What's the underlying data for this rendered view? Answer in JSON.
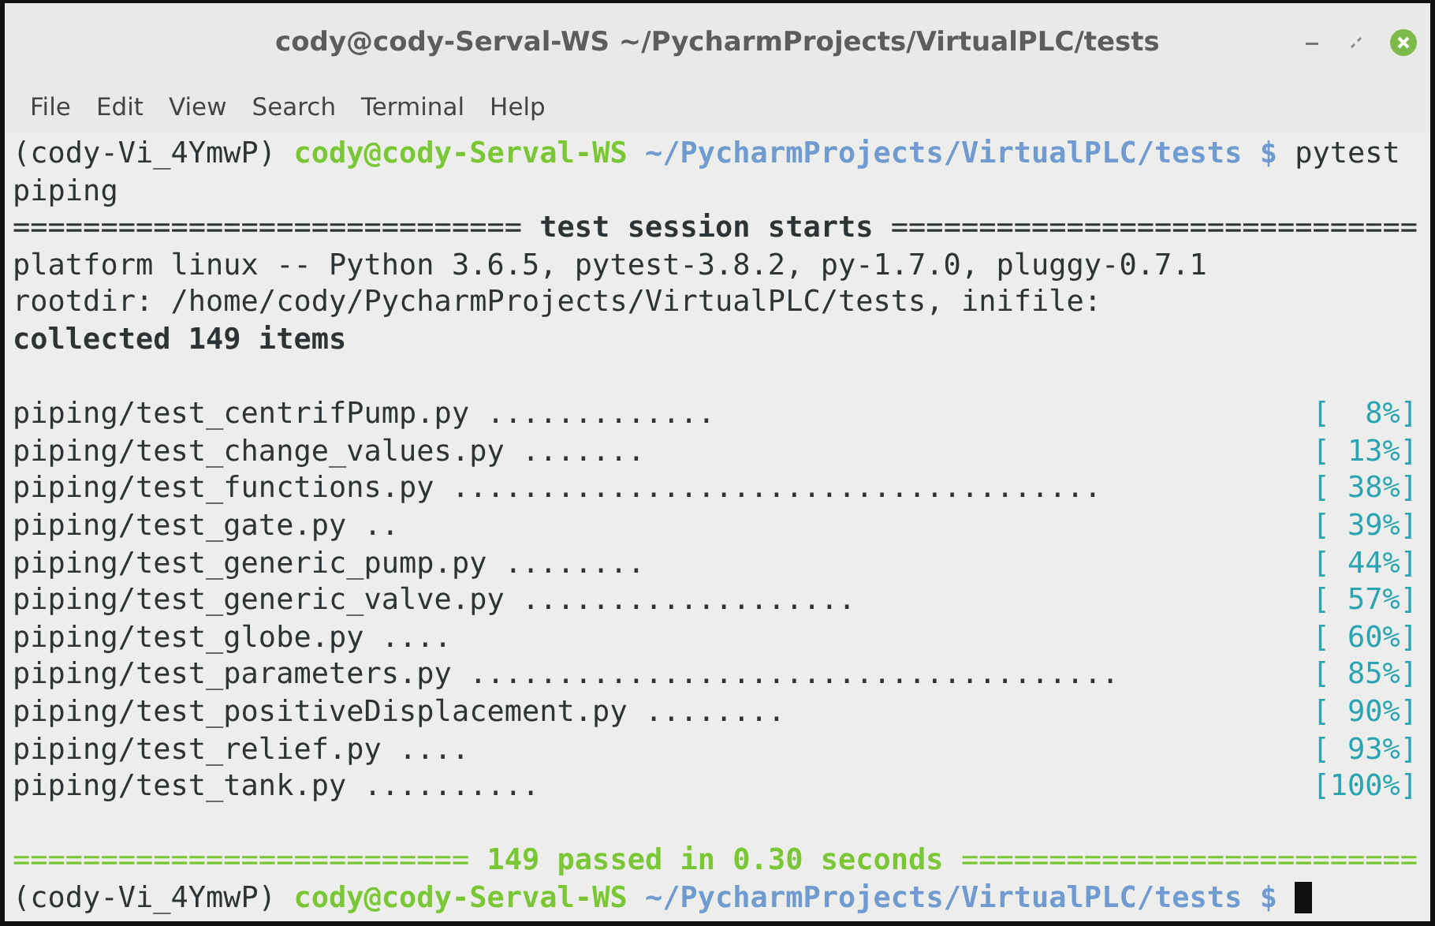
{
  "window": {
    "title": "cody@cody-Serval-WS ~/PycharmProjects/VirtualPLC/tests"
  },
  "menu": {
    "items": [
      "File",
      "Edit",
      "View",
      "Search",
      "Terminal",
      "Help"
    ]
  },
  "terminal": {
    "lines": [
      {
        "kind": "prompt",
        "env": "(cody-Vi_4YmwP)",
        "user_host": "cody@cody-Serval-WS",
        "path": "~/PycharmProjects/VirtualPLC/tests",
        "symbol": "$",
        "command": "pytest",
        "cursor": false
      },
      {
        "kind": "plain",
        "text": "piping"
      },
      {
        "kind": "separator",
        "text": "============================= **test session starts** =============================="
      },
      {
        "kind": "plain",
        "text": "platform linux -- Python 3.6.5, pytest-3.8.2, py-1.7.0, pluggy-0.7.1"
      },
      {
        "kind": "plain",
        "text": "rootdir: /home/cody/PycharmProjects/VirtualPLC/tests, inifile:"
      },
      {
        "kind": "bold",
        "text": "collected 149 items"
      },
      {
        "kind": "blank"
      },
      {
        "kind": "test",
        "name": "piping/test_centrifPump.py",
        "dots": ".............",
        "percent": "[  8%]"
      },
      {
        "kind": "test",
        "name": "piping/test_change_values.py",
        "dots": ".......",
        "percent": "[ 13%]"
      },
      {
        "kind": "test",
        "name": "piping/test_functions.py",
        "dots": ".....................................",
        "percent": "[ 38%]"
      },
      {
        "kind": "test",
        "name": "piping/test_gate.py",
        "dots": "..",
        "percent": "[ 39%]"
      },
      {
        "kind": "test",
        "name": "piping/test_generic_pump.py",
        "dots": "........",
        "percent": "[ 44%]"
      },
      {
        "kind": "test",
        "name": "piping/test_generic_valve.py",
        "dots": "...................",
        "percent": "[ 57%]"
      },
      {
        "kind": "test",
        "name": "piping/test_globe.py",
        "dots": "....",
        "percent": "[ 60%]"
      },
      {
        "kind": "test",
        "name": "piping/test_parameters.py",
        "dots": ".....................................",
        "percent": "[ 85%]"
      },
      {
        "kind": "test",
        "name": "piping/test_positiveDisplacement.py",
        "dots": "........",
        "percent": "[ 90%]"
      },
      {
        "kind": "test",
        "name": "piping/test_relief.py",
        "dots": "....",
        "percent": "[ 93%]"
      },
      {
        "kind": "test",
        "name": "piping/test_tank.py",
        "dots": "..........",
        "percent": "[100%]"
      },
      {
        "kind": "blank"
      },
      {
        "kind": "summary",
        "text": "========================== **149 passed in 0.30 seconds** =========================="
      },
      {
        "kind": "prompt",
        "env": "(cody-Vi_4YmwP)",
        "user_host": "cody@cody-Serval-WS",
        "path": "~/PycharmProjects/VirtualPLC/tests",
        "symbol": "$",
        "cursor": true
      }
    ]
  }
}
